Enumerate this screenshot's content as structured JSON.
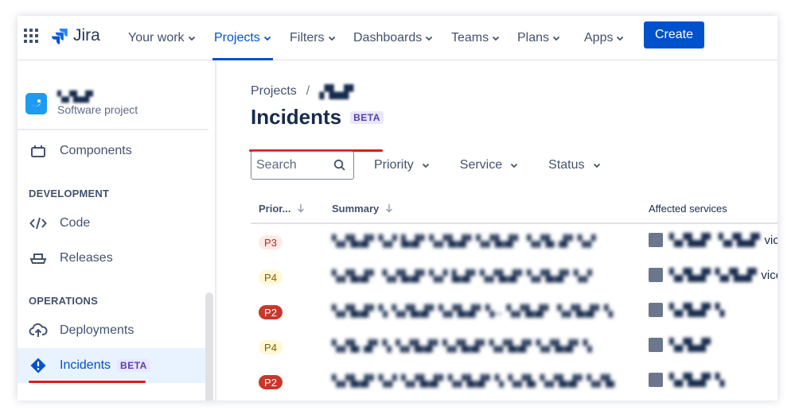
{
  "nav": {
    "product": "Jira",
    "items": [
      {
        "label": "Your work"
      },
      {
        "label": "Projects",
        "active": true
      },
      {
        "label": "Filters"
      },
      {
        "label": "Dashboards"
      },
      {
        "label": "Teams"
      },
      {
        "label": "Plans"
      },
      {
        "label": "Apps"
      }
    ],
    "create_label": "Create"
  },
  "sidebar": {
    "project_name": "▚▞▙▟▘",
    "project_type": "Software project",
    "items": [
      {
        "label": "Components"
      },
      {
        "label": "Code"
      },
      {
        "label": "Releases"
      },
      {
        "label": "Deployments"
      },
      {
        "label": "Incidents",
        "badge": "BETA",
        "selected": true
      }
    ],
    "sections": {
      "development": "DEVELOPMENT",
      "operations": "OPERATIONS"
    }
  },
  "main": {
    "breadcrumb": {
      "root": "Projects",
      "separator": "/",
      "current": "▞▙▟▘"
    },
    "title": "Incidents",
    "title_badge": "BETA",
    "search_placeholder": "Search",
    "filters": [
      "Priority",
      "Service",
      "Status"
    ],
    "table": {
      "columns": {
        "priority": "Prior...",
        "summary": "Summary",
        "services": "Affected services"
      },
      "rows": [
        {
          "priority": "P3",
          "summary": "▚▞▙▟▘▚▞ ▙▟▘▚▞▙▟▘▚▞▙▟▘ ▚▞▙ ▟▘▚▞",
          "service_blur": "▚▞▙▟▘ ▚▞▙▟▘",
          "service_suffix": "vice"
        },
        {
          "priority": "P4",
          "summary": "▚▞▙▟▘ ▚▞▙▟▘▚▞ ▙▟▘▚▞▙▟▘▚▞▙▟▘▚▞",
          "service_blur": "▚▞▙▟▘▚▞▙▟▘",
          "service_suffix": "vice"
        },
        {
          "priority": "P2",
          "summary": "▚▞▙▟▘▚ ▚▞▙▟▘▚▞▙▟▘▚.. ▚▞▙▟▘ ▚▞▙▟▘▚",
          "service_blur": "▚▞▙▟▘▚",
          "service_suffix": ""
        },
        {
          "priority": "P4",
          "summary": "▚▞▙ ▟▘▚ ▚▞▙▟▘▚▞▙▟▘▚▞▙▟▘▚▞▙▟▘▚",
          "service_blur": "▚▞▙▟▘",
          "service_suffix": ""
        },
        {
          "priority": "P2",
          "summary": "▚▞▙▟▘▚▞ ▚▞▙▟▘▚▞▙▟▘▚ ▚▞▙ ▚▞▙▟▘▚▞▙",
          "service_blur": "▚▞▙▟▘▚",
          "service_suffix": ""
        }
      ]
    }
  },
  "colors": {
    "accent": "#0052cc",
    "annotation_red": "#de1c1c",
    "p2_bg": "#c9372c",
    "p3_bg": "#ffebe6",
    "p3_fg": "#ae2e24",
    "p4_bg": "#fff7d6",
    "p4_fg": "#7f5f01"
  }
}
